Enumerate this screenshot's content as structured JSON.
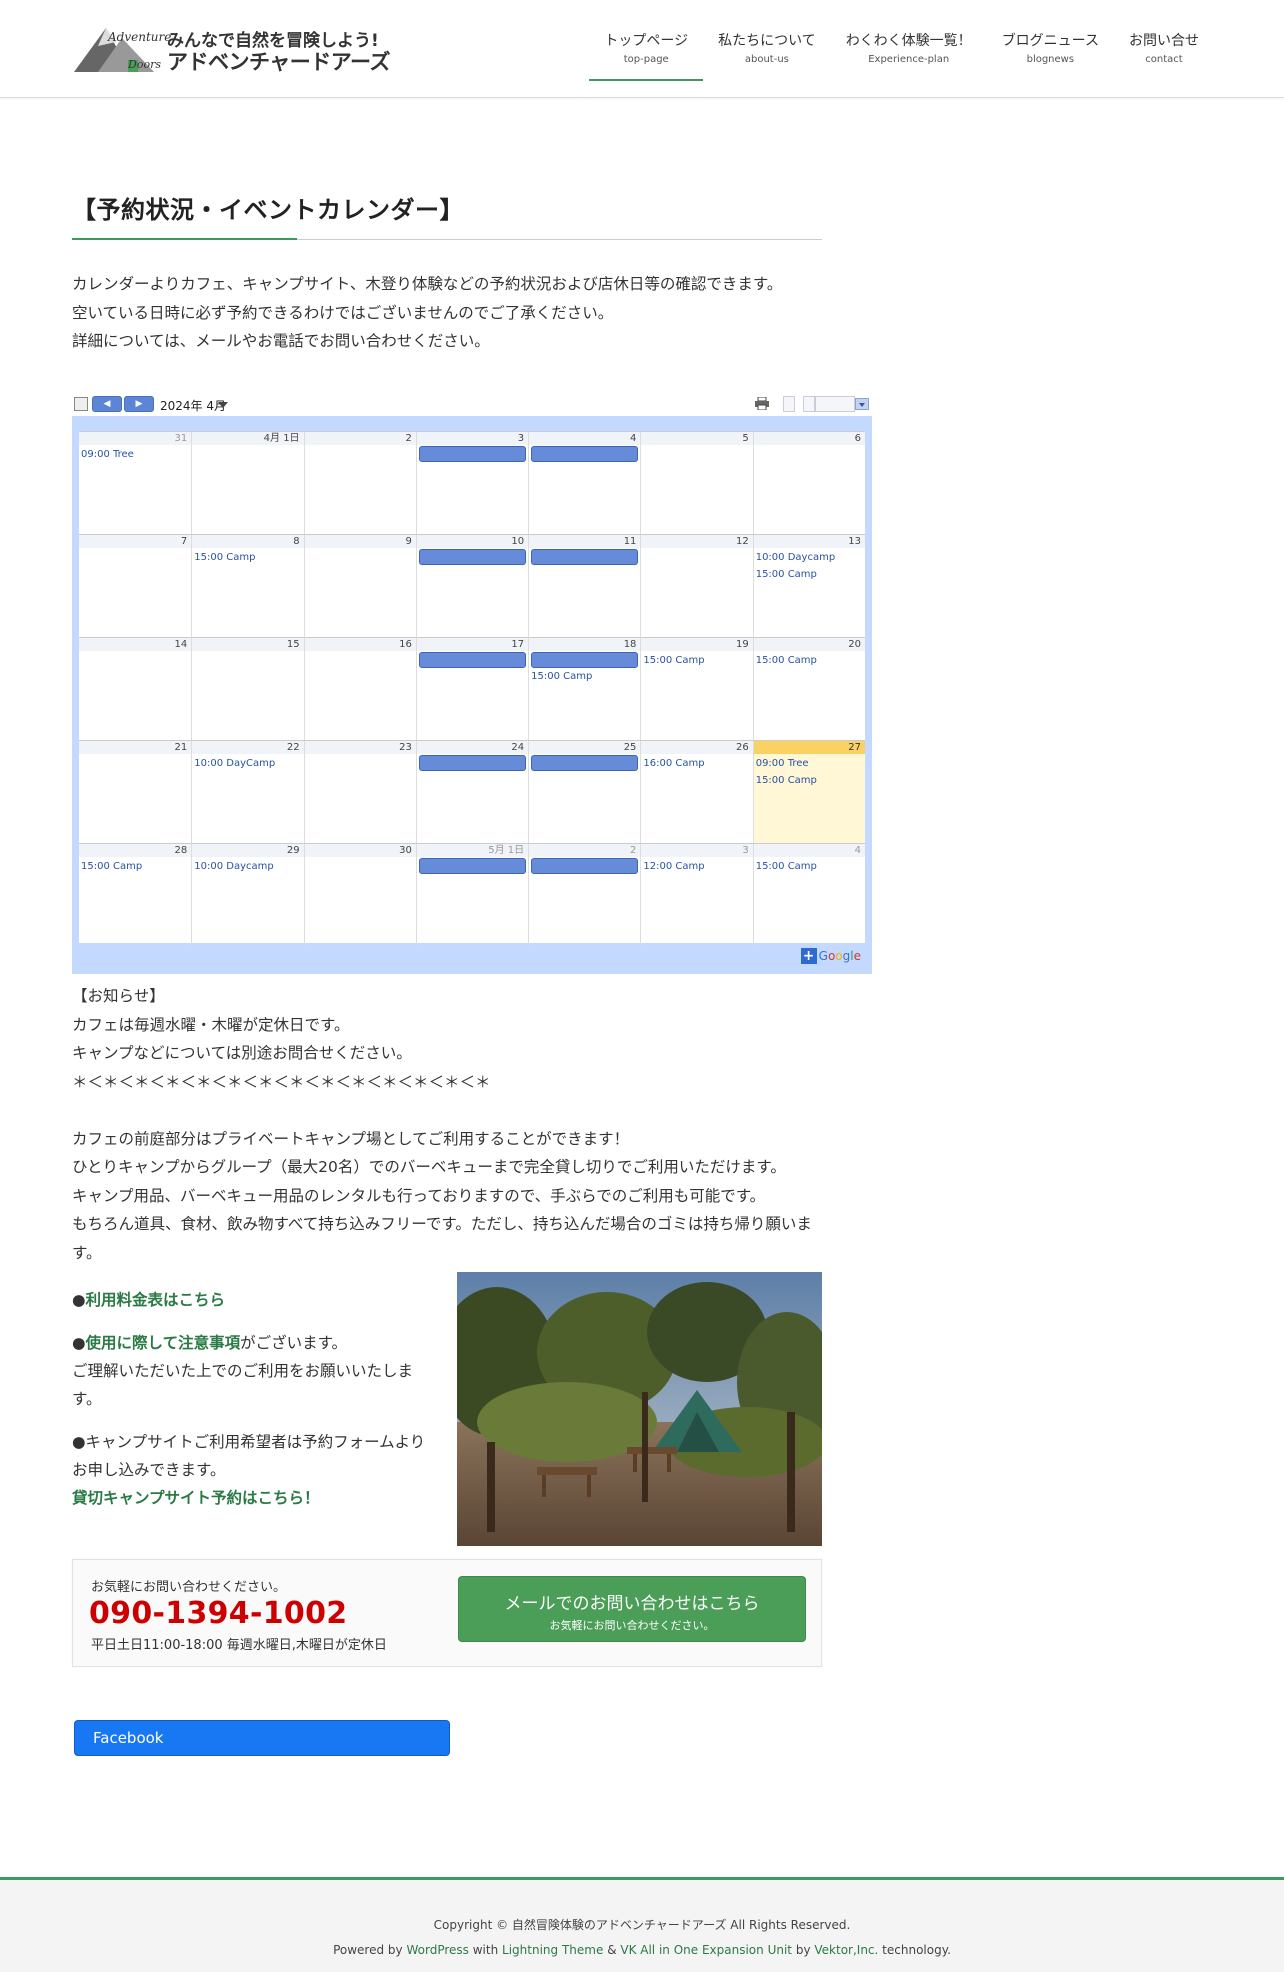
{
  "header": {
    "logo_adventure": "Adventure",
    "logo_doors": "Doors",
    "logo_tagline": "みんなで自然を冒険しよう!",
    "logo_name": "アドベンチャードアーズ",
    "nav": [
      {
        "jp": "トップページ",
        "en": "top-page"
      },
      {
        "jp": "私たちについて",
        "en": "about-us"
      },
      {
        "jp": "わくわく体験一覧！",
        "en": "Experience-plan"
      },
      {
        "jp": "ブログニュース",
        "en": "blognews"
      },
      {
        "jp": "お問い合せ",
        "en": "contact"
      }
    ]
  },
  "main": {
    "title": "【予約状況・イベントカレンダー】",
    "intro": [
      "カレンダーよりカフェ、キャンプサイト、木登り体験などの予約状況および店休日等の確認できます。",
      "空いている日時に必ず予約できるわけではございませんのでご了承ください。",
      "詳細については、メールやお電話でお問い合わせください。"
    ]
  },
  "calendar": {
    "label": "",
    "month": "2024年 4月",
    "print_label": "",
    "dropdown_label": "",
    "footer_text": "",
    "google_text": "Google",
    "bar_text": "",
    "dow": [
      "",
      "",
      "",
      "",
      "",
      "",
      ""
    ],
    "weeks": [
      {
        "days": [
          {
            "num": "31",
            "other": true,
            "events": [
              "09:00 Tree"
            ]
          },
          {
            "num": "4月 1日",
            "events": []
          },
          {
            "num": "2",
            "events": []
          },
          {
            "num": "3",
            "bar": true,
            "events": []
          },
          {
            "num": "4",
            "bar": true,
            "events": []
          },
          {
            "num": "5",
            "events": []
          },
          {
            "num": "6",
            "events": []
          }
        ]
      },
      {
        "days": [
          {
            "num": "7",
            "events": []
          },
          {
            "num": "8",
            "events": [
              "15:00 Camp"
            ]
          },
          {
            "num": "9",
            "events": []
          },
          {
            "num": "10",
            "bar": true,
            "events": []
          },
          {
            "num": "11",
            "bar": true,
            "events": []
          },
          {
            "num": "12",
            "events": []
          },
          {
            "num": "13",
            "events": [
              "10:00 Daycamp",
              "15:00 Camp"
            ]
          }
        ]
      },
      {
        "days": [
          {
            "num": "14",
            "events": []
          },
          {
            "num": "15",
            "events": []
          },
          {
            "num": "16",
            "events": []
          },
          {
            "num": "17",
            "bar": true,
            "events": []
          },
          {
            "num": "18",
            "bar": true,
            "events": [
              "15:00 Camp"
            ]
          },
          {
            "num": "19",
            "events": [
              "15:00 Camp"
            ]
          },
          {
            "num": "20",
            "events": [
              "15:00 Camp"
            ]
          }
        ]
      },
      {
        "days": [
          {
            "num": "21",
            "events": []
          },
          {
            "num": "22",
            "events": [
              "10:00 DayCamp"
            ]
          },
          {
            "num": "23",
            "events": []
          },
          {
            "num": "24",
            "bar": true,
            "events": []
          },
          {
            "num": "25",
            "bar": true,
            "events": []
          },
          {
            "num": "26",
            "events": [
              "16:00 Camp"
            ]
          },
          {
            "num": "27",
            "today": true,
            "events": [
              "09:00 Tree",
              "15:00 Camp"
            ]
          }
        ]
      },
      {
        "days": [
          {
            "num": "28",
            "events": [
              "15:00 Camp"
            ]
          },
          {
            "num": "29",
            "events": [
              "10:00 Daycamp"
            ]
          },
          {
            "num": "30",
            "events": []
          },
          {
            "num": "5月 1日",
            "other": true,
            "bar": true,
            "events": []
          },
          {
            "num": "2",
            "other": true,
            "bar": true,
            "events": []
          },
          {
            "num": "3",
            "other": true,
            "events": [
              "12:00 Camp"
            ]
          },
          {
            "num": "4",
            "other": true,
            "events": [
              "15:00 Camp"
            ]
          }
        ]
      }
    ]
  },
  "notice": {
    "heading": "【お知らせ】",
    "line1": "カフェは毎週水曜・木曜が定休日です。",
    "line2": "キャンプなどについては別途お問合せください。",
    "line3": "＊＜＊＜＊＜＊＜＊＜＊＜＊＜＊＜＊＜＊＜＊＜＊＜＊＜＊",
    "p1": "カフェの前庭部分はプライベートキャンプ場としてご利用することができます！",
    "p2": "ひとりキャンプからグループ（最大20名）でのバーベキューまで完全貸し切りでご利用いただけます。",
    "p3": "キャンプ用品、バーベキュー用品のレンタルも行っておりますので、手ぶらでのご利用も可能です。",
    "p4": "もちろん道具、食材、飲み物すべて持ち込みフリーです。ただし、持ち込んだ場合のゴミは持ち帰り願います。"
  },
  "info": {
    "bullet": "●",
    "fee_link": "利用料金表はこちら",
    "caution_link": "使用に際して注意事項",
    "caution_rest": "がございます。",
    "caution_line2": "ご理解いただいた上でのご利用をお願いいたします。",
    "reserve_text": "キャンプサイトご利用希望者は予約フォームよりお申し込みできます。",
    "reserve_link": "貸切キャンプサイト予約はこちら！"
  },
  "contact": {
    "msg": "お気軽にお問い合わせください。",
    "phone": "090-1394-1002",
    "hours": "平日土日11:00-18:00 毎週水曜日,木曜日が定休日",
    "btn_title": "メールでのお問い合わせはこちら",
    "btn_sub": "お気軽にお問い合わせください。"
  },
  "facebook": {
    "label": "Facebook"
  },
  "footer": {
    "copyright": "Copyright © 自然冒険体験のアドベンチャードアーズ All Rights Reserved.",
    "powered_by": "Powered by",
    "wordpress": "WordPress",
    "with": "with",
    "lightning": "Lightning Theme",
    "amp": "&",
    "vk": "VK All in One Expansion Unit",
    "by": "by",
    "vektor": "Vektor,Inc.",
    "tech": "technology."
  },
  "colors": {
    "accent": "#3c9a5f",
    "phone": "#cc0000",
    "contact_button": "#4a9e57",
    "facebook": "#1877f2",
    "calendar_bar": "#668cd9",
    "today": "#fad163"
  }
}
